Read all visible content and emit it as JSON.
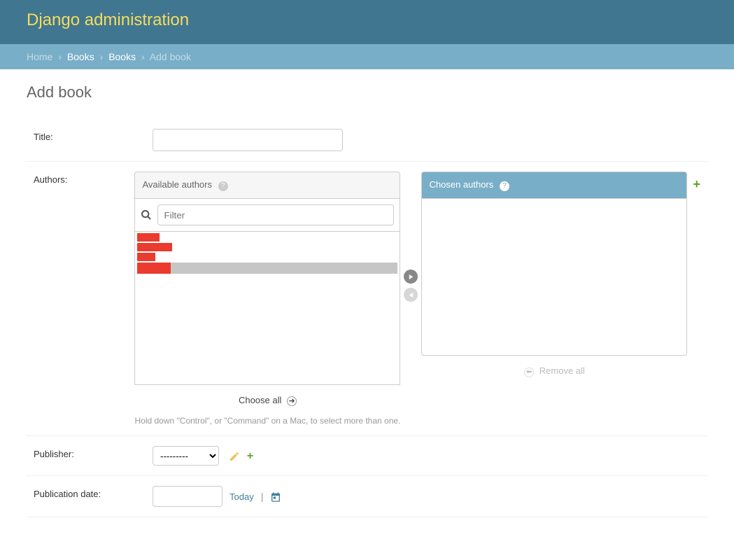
{
  "header": {
    "title": "Django administration"
  },
  "breadcrumbs": {
    "home": "Home",
    "app": "Books",
    "model": "Books",
    "current": "Add book"
  },
  "page_title": "Add book",
  "fields": {
    "title": {
      "label": "Title:"
    },
    "authors": {
      "label": "Authors:",
      "available_header": "Available authors",
      "chosen_header": "Chosen authors",
      "filter_placeholder": "Filter",
      "choose_all": "Choose all",
      "remove_all": "Remove all",
      "help": "Hold down \"Control\", or \"Command\" on a Mac, to select more than one."
    },
    "publisher": {
      "label": "Publisher:",
      "selected": "---------"
    },
    "pubdate": {
      "label": "Publication date:",
      "today": "Today"
    }
  }
}
